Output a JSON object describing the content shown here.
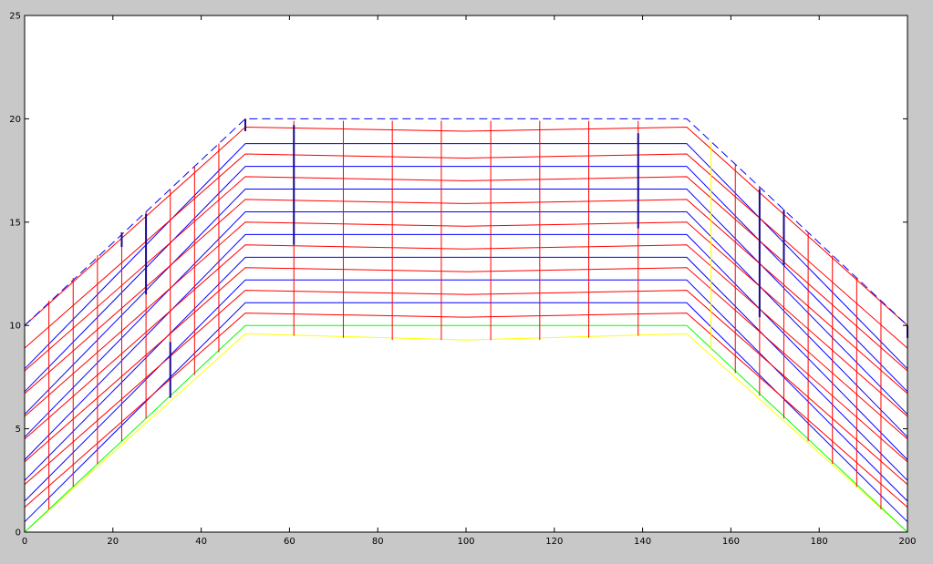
{
  "chart_data": {
    "type": "line",
    "title": "",
    "xlabel": "",
    "ylabel": "",
    "xlim": [
      0,
      200
    ],
    "ylim": [
      0,
      25
    ],
    "grid": false,
    "x_ticks": [
      0,
      20,
      40,
      60,
      80,
      100,
      120,
      140,
      160,
      180,
      200
    ],
    "y_ticks": [
      0,
      5,
      10,
      15,
      20,
      25
    ],
    "colors": {
      "background": "#c8c8c8",
      "plot_area": "#ffffff",
      "red": "#ff0000",
      "blue": "#0000ff",
      "green": "#00ff00",
      "yellow": "#ffff00",
      "dark_blue": "#1a0a8c"
    },
    "series": [
      {
        "color": "yellow",
        "style": "solid",
        "x": [
          0,
          50,
          100,
          150,
          200
        ],
        "y": [
          0,
          9.6,
          9.3,
          9.6,
          0
        ]
      },
      {
        "color": "green",
        "style": "solid",
        "x": [
          0,
          50,
          150,
          200
        ],
        "y": [
          0,
          10,
          10,
          0
        ]
      },
      {
        "color": "blue",
        "style": "solid",
        "x": [
          0,
          50,
          150,
          200
        ],
        "y": [
          0.5,
          11.1,
          11.1,
          0.5
        ]
      },
      {
        "color": "blue",
        "style": "solid",
        "x": [
          0,
          50,
          150,
          200
        ],
        "y": [
          1.5,
          12.2,
          12.2,
          1.5
        ]
      },
      {
        "color": "blue",
        "style": "solid",
        "x": [
          0,
          50,
          150,
          200
        ],
        "y": [
          2.5,
          13.3,
          13.3,
          2.5
        ]
      },
      {
        "color": "blue",
        "style": "solid",
        "x": [
          0,
          50,
          150,
          200
        ],
        "y": [
          3.5,
          14.4,
          14.4,
          3.5
        ]
      },
      {
        "color": "blue",
        "style": "solid",
        "x": [
          0,
          50,
          150,
          200
        ],
        "y": [
          4.6,
          15.5,
          15.5,
          4.6
        ]
      },
      {
        "color": "blue",
        "style": "solid",
        "x": [
          0,
          50,
          150,
          200
        ],
        "y": [
          5.7,
          16.6,
          16.6,
          5.7
        ]
      },
      {
        "color": "blue",
        "style": "solid",
        "x": [
          0,
          50,
          150,
          200
        ],
        "y": [
          6.8,
          17.7,
          17.7,
          6.8
        ]
      },
      {
        "color": "blue",
        "style": "solid",
        "x": [
          0,
          50,
          150,
          200
        ],
        "y": [
          7.9,
          18.8,
          18.8,
          7.9
        ]
      },
      {
        "color": "red",
        "style": "solid",
        "x": [
          0,
          50,
          100,
          150,
          200
        ],
        "y": [
          1.2,
          10.6,
          10.4,
          10.6,
          1.2
        ]
      },
      {
        "color": "red",
        "style": "solid",
        "x": [
          0,
          50,
          100,
          150,
          200
        ],
        "y": [
          2.3,
          11.7,
          11.5,
          11.7,
          2.3
        ]
      },
      {
        "color": "red",
        "style": "solid",
        "x": [
          0,
          50,
          100,
          150,
          200
        ],
        "y": [
          3.4,
          12.8,
          12.6,
          12.8,
          3.4
        ]
      },
      {
        "color": "red",
        "style": "solid",
        "x": [
          0,
          50,
          100,
          150,
          200
        ],
        "y": [
          4.5,
          13.9,
          13.7,
          13.9,
          4.5
        ]
      },
      {
        "color": "red",
        "style": "solid",
        "x": [
          0,
          50,
          100,
          150,
          200
        ],
        "y": [
          5.6,
          15.0,
          14.8,
          15.0,
          5.6
        ]
      },
      {
        "color": "red",
        "style": "solid",
        "x": [
          0,
          50,
          100,
          150,
          200
        ],
        "y": [
          6.7,
          16.1,
          15.9,
          16.1,
          6.7
        ]
      },
      {
        "color": "red",
        "style": "solid",
        "x": [
          0,
          50,
          100,
          150,
          200
        ],
        "y": [
          7.8,
          17.2,
          17.0,
          17.2,
          7.8
        ]
      },
      {
        "color": "red",
        "style": "solid",
        "x": [
          0,
          50,
          100,
          150,
          200
        ],
        "y": [
          8.9,
          18.3,
          18.1,
          18.3,
          8.9
        ]
      },
      {
        "color": "red",
        "style": "solid",
        "x": [
          0,
          50,
          100,
          150,
          200
        ],
        "y": [
          10.0,
          19.6,
          19.4,
          19.6,
          10.0
        ]
      },
      {
        "color": "blue",
        "style": "dashed",
        "x": [
          0,
          50,
          150,
          200
        ],
        "y": [
          10,
          20,
          20,
          10
        ]
      }
    ],
    "verticals": [
      {
        "x": 5.5,
        "y0": 1.1,
        "y1": 11.2,
        "color": "red"
      },
      {
        "x": 11,
        "y0": 2.2,
        "y1": 12.3,
        "color": "red"
      },
      {
        "x": 16.5,
        "y0": 3.3,
        "y1": 13.4,
        "color": "red"
      },
      {
        "x": 22,
        "y0": 4.4,
        "y1": 14.5,
        "color": "red"
      },
      {
        "x": 27.5,
        "y0": 5.5,
        "y1": 15.5,
        "color": "red"
      },
      {
        "x": 33,
        "y0": 6.6,
        "y1": 16.6,
        "color": "red"
      },
      {
        "x": 38.5,
        "y0": 7.6,
        "y1": 17.7,
        "color": "red"
      },
      {
        "x": 44,
        "y0": 8.7,
        "y1": 18.8,
        "color": "red"
      },
      {
        "x": 61,
        "y0": 9.5,
        "y1": 19.9,
        "color": "red"
      },
      {
        "x": 72.2,
        "y0": 9.4,
        "y1": 19.9,
        "color": "red"
      },
      {
        "x": 83.3,
        "y0": 9.3,
        "y1": 19.9,
        "color": "red"
      },
      {
        "x": 94.4,
        "y0": 9.3,
        "y1": 19.9,
        "color": "red"
      },
      {
        "x": 105.6,
        "y0": 9.3,
        "y1": 19.9,
        "color": "red"
      },
      {
        "x": 116.7,
        "y0": 9.3,
        "y1": 19.9,
        "color": "red"
      },
      {
        "x": 127.8,
        "y0": 9.4,
        "y1": 19.9,
        "color": "red"
      },
      {
        "x": 139,
        "y0": 9.5,
        "y1": 19.9,
        "color": "red"
      },
      {
        "x": 155.5,
        "y0": 8.8,
        "y1": 18.9,
        "color": "yellow"
      },
      {
        "x": 161,
        "y0": 7.7,
        "y1": 17.8,
        "color": "red"
      },
      {
        "x": 166.5,
        "y0": 6.6,
        "y1": 16.7,
        "color": "red"
      },
      {
        "x": 172,
        "y0": 5.5,
        "y1": 15.6,
        "color": "red"
      },
      {
        "x": 177.5,
        "y0": 4.4,
        "y1": 14.5,
        "color": "red"
      },
      {
        "x": 183,
        "y0": 3.3,
        "y1": 13.4,
        "color": "red"
      },
      {
        "x": 188.5,
        "y0": 2.2,
        "y1": 12.3,
        "color": "red"
      },
      {
        "x": 194,
        "y0": 1.1,
        "y1": 11.2,
        "color": "red"
      },
      {
        "x": 200,
        "y0": 0,
        "y1": 10,
        "color": "red"
      }
    ],
    "dark_segments": [
      {
        "x": 22,
        "y0": 13.8,
        "y1": 14.5
      },
      {
        "x": 27.5,
        "y0": 11.5,
        "y1": 15.4
      },
      {
        "x": 33,
        "y0": 6.5,
        "y1": 9.2
      },
      {
        "x": 50,
        "y0": 19.4,
        "y1": 20
      },
      {
        "x": 61,
        "y0": 13.9,
        "y1": 19.7
      },
      {
        "x": 139,
        "y0": 14.7,
        "y1": 19.3
      },
      {
        "x": 166.5,
        "y0": 10.4,
        "y1": 16.6
      },
      {
        "x": 172,
        "y0": 12.9,
        "y1": 15.6
      },
      {
        "x": 200,
        "y0": 9.4,
        "y1": 10
      }
    ]
  }
}
